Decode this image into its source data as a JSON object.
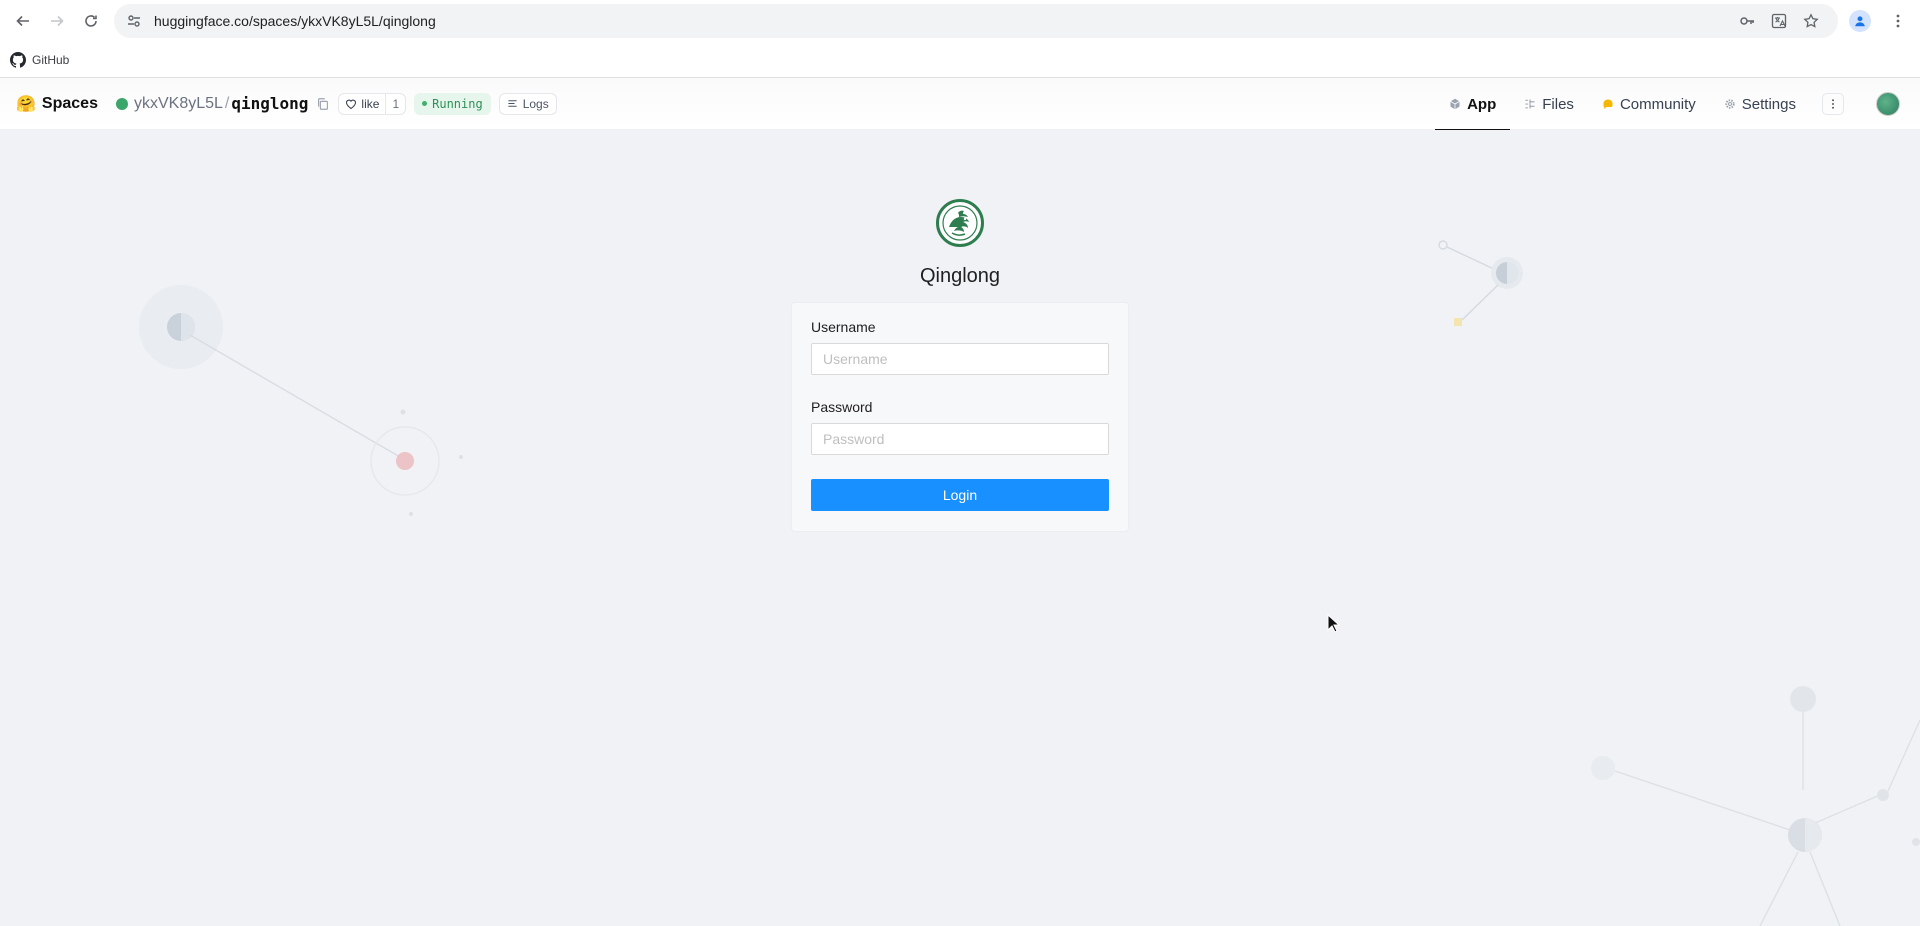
{
  "browser": {
    "url": "huggingface.co/spaces/ykxVK8yL5L/qinglong",
    "bookmarks": [
      {
        "label": "GitHub"
      }
    ]
  },
  "hf": {
    "brand": "Spaces",
    "owner": "ykxVK8yL5L",
    "repo": "qinglong",
    "like_label": "like",
    "like_count": "1",
    "status": "Running",
    "logs_label": "Logs",
    "tabs": [
      {
        "label": "App",
        "icon": "cube-icon",
        "active": true
      },
      {
        "label": "Files",
        "icon": "files-icon",
        "active": false
      },
      {
        "label": "Community",
        "icon": "community-icon",
        "active": false
      },
      {
        "label": "Settings",
        "icon": "gear-icon",
        "active": false
      }
    ]
  },
  "app": {
    "title": "Qinglong",
    "username_label": "Username",
    "username_placeholder": "Username",
    "password_label": "Password",
    "password_placeholder": "Password",
    "login_label": "Login"
  },
  "colors": {
    "primary": "#1890ff",
    "running_green": "#2f8f57",
    "logo_green": "#2e7d4f"
  }
}
